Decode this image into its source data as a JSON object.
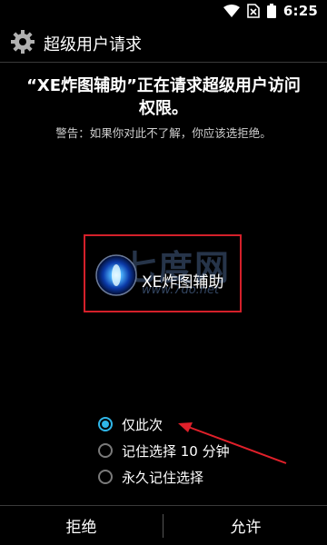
{
  "status_bar": {
    "time": "6:25",
    "icons": [
      "wifi-icon",
      "no-sim-icon",
      "battery-icon"
    ]
  },
  "dialog": {
    "title": "超级用户请求",
    "message": "“XE炸图辅助”正在请求超级用户访问权限。",
    "warning": "警告：如果你对此不了解，你应该选拒绝。",
    "app": {
      "name": "XE炸图辅助",
      "watermark": "七度网",
      "watermark_url": "www.7do.net"
    },
    "options": [
      {
        "label": "仅此次",
        "selected": true
      },
      {
        "label": "记住选择 10 分钟",
        "selected": false
      },
      {
        "label": "永久记住选择",
        "selected": false
      }
    ],
    "buttons": {
      "deny": "拒绝",
      "allow": "允许"
    }
  },
  "colors": {
    "accent": "#2fb6e8",
    "highlight_box": "#d4202a",
    "background": "#000000"
  }
}
